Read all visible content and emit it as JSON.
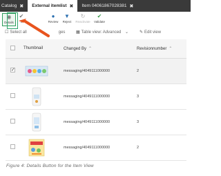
{
  "tabs": [
    {
      "label": "Catalog",
      "active": false
    },
    {
      "label": "External itemlist",
      "active": true
    },
    {
      "label": "Item 04061867028381",
      "active": false
    }
  ],
  "toolbar": {
    "details_label": "Details",
    "second_label": "S",
    "review_label": "Review",
    "reject_label": "Reject",
    "reactivate_label": "Reactivate",
    "validate_label": "Validate"
  },
  "subbar": {
    "select_all": "Select all",
    "select_all_tail": "ges",
    "table_view": "Table view: Advanced",
    "edit_view": "Edit view"
  },
  "table": {
    "columns": {
      "thumbnail": "Thumbnail",
      "changed_by": "Changed By",
      "revision": "Revisionnumber"
    },
    "rows": [
      {
        "changed_by": "messaging/4049111000000",
        "revision": "2",
        "checked": true
      },
      {
        "changed_by": "messaging/4049111000000",
        "revision": "3",
        "checked": false
      },
      {
        "changed_by": "messaging/4049111000000",
        "revision": "3",
        "checked": false
      },
      {
        "changed_by": "messaging/4049111000000",
        "revision": "2",
        "checked": false
      }
    ]
  },
  "caption": "Figure 4: Details Button for the Item View",
  "colors": {
    "tabbar": "#3a3a3a",
    "highlight": "#2fa36b",
    "arrow": "#e8541e"
  }
}
